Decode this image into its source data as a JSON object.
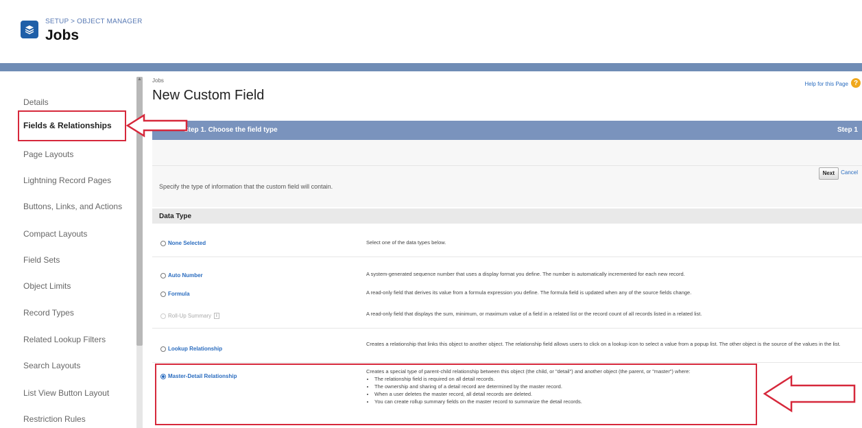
{
  "header": {
    "breadcrumb": "SETUP > OBJECT MANAGER",
    "title": "Jobs"
  },
  "sidebar": {
    "items": [
      {
        "label": "Details"
      },
      {
        "label": "Fields & Relationships"
      },
      {
        "label": "Page Layouts"
      },
      {
        "label": "Lightning Record Pages"
      },
      {
        "label": "Buttons, Links, and Actions"
      },
      {
        "label": "Compact Layouts"
      },
      {
        "label": "Field Sets"
      },
      {
        "label": "Object Limits"
      },
      {
        "label": "Record Types"
      },
      {
        "label": "Related Lookup Filters"
      },
      {
        "label": "Search Layouts"
      },
      {
        "label": "List View Button Layout"
      },
      {
        "label": "Restriction Rules"
      }
    ]
  },
  "main": {
    "crumb": "Jobs",
    "title": "New Custom Field",
    "help_label": "Help for this Page",
    "step_title": "Step 1. Choose the field type",
    "step_num": "Step 1",
    "next_label": "Next",
    "cancel_label": "Cancel",
    "instruction": "Specify the type of information that the custom field will contain.",
    "data_type_label": "Data Type",
    "options": [
      {
        "label": "None Selected",
        "desc": "Select one of the data types below."
      },
      {
        "label": "Auto Number",
        "desc": "A system-generated sequence number that uses a display format you define. The number is automatically incremented for each new record."
      },
      {
        "label": "Formula",
        "desc": "A read-only field that derives its value from a formula expression you define. The formula field is updated when any of the source fields change."
      },
      {
        "label": "Roll-Up Summary",
        "info": "i",
        "desc": "A read-only field that displays the sum, minimum, or maximum value of a field in a related list or the record count of all records listed in a related list."
      },
      {
        "label": "Lookup Relationship",
        "desc": "Creates a relationship that links this object to another object. The relationship field allows users to click on a lookup icon to select a value from a popup list. The other object is the source of the values in the list."
      },
      {
        "label": "Master-Detail Relationship",
        "desc": "Creates a special type of parent-child relationship between this object (the child, or \"detail\") and another object (the parent, or \"master\") where:",
        "bullets": [
          "The relationship field is required on all detail records.",
          "The ownership and sharing of a detail record are determined by the master record.",
          "When a user deletes the master record, all detail records are deleted.",
          "You can create rollup summary fields on the master record to summarize the detail records."
        ]
      }
    ]
  },
  "colors": {
    "band": "#6f8cb5",
    "step_bar": "#7a93bd",
    "annotation": "#d6283b",
    "link": "#2a6cbf"
  }
}
